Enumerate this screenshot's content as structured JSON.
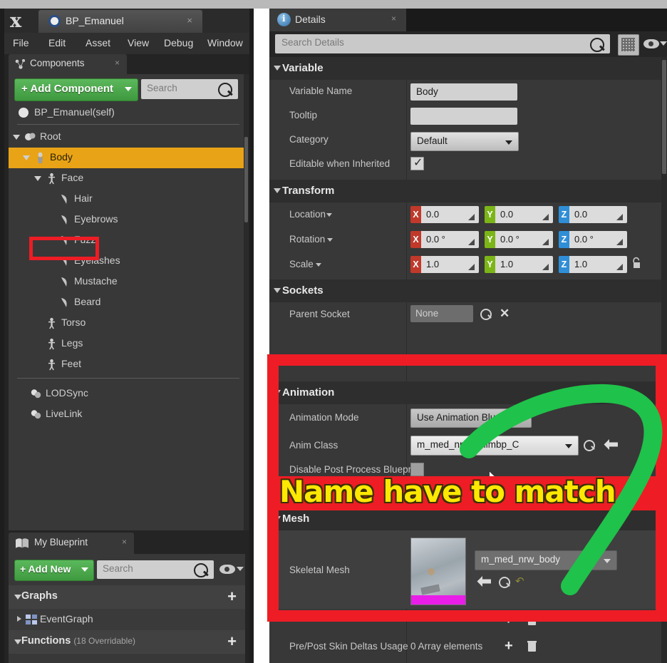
{
  "window": {
    "logo": "unreal-logo",
    "tab_label": "BP_Emanuel",
    "tab_close": "×",
    "menu": [
      "File",
      "Edit",
      "Asset",
      "View",
      "Debug",
      "Window"
    ]
  },
  "components_panel": {
    "tab_label": "Components",
    "tab_close": "×",
    "add_button": "+ Add Component",
    "search_placeholder": "Search",
    "self_item": "BP_Emanuel(self)",
    "tree": [
      {
        "label": "Root",
        "indent": 22,
        "icon": "sphere-mesh-icon",
        "arrow": "open",
        "selected": false
      },
      {
        "label": "Body",
        "indent": 36,
        "icon": "skeletal-mesh-icon",
        "arrow": "open",
        "selected": true
      },
      {
        "label": "Face",
        "indent": 52,
        "icon": "person-icon",
        "arrow": "open",
        "selected": false
      },
      {
        "label": "Hair",
        "indent": 70,
        "icon": "groom-icon",
        "arrow": "none",
        "selected": false
      },
      {
        "label": "Eyebrows",
        "indent": 70,
        "icon": "groom-icon",
        "arrow": "none",
        "selected": false
      },
      {
        "label": "Fuzz",
        "indent": 70,
        "icon": "groom-icon",
        "arrow": "none",
        "selected": false
      },
      {
        "label": "Eyelashes",
        "indent": 70,
        "icon": "groom-icon",
        "arrow": "none",
        "selected": false
      },
      {
        "label": "Mustache",
        "indent": 70,
        "icon": "groom-icon",
        "arrow": "none",
        "selected": false
      },
      {
        "label": "Beard",
        "indent": 70,
        "icon": "groom-icon",
        "arrow": "none",
        "selected": false
      },
      {
        "label": "Torso",
        "indent": 52,
        "icon": "person-icon",
        "arrow": "none",
        "selected": false
      },
      {
        "label": "Legs",
        "indent": 52,
        "icon": "person-icon",
        "arrow": "none",
        "selected": false
      },
      {
        "label": "Feet",
        "indent": 52,
        "icon": "person-icon",
        "arrow": "none",
        "selected": false
      },
      {
        "label": "LODSync",
        "indent": 30,
        "icon": "blueprint-component-icon",
        "arrow": "none",
        "selected": false
      },
      {
        "label": "LiveLink",
        "indent": 30,
        "icon": "blueprint-component-icon",
        "arrow": "none",
        "selected": false
      }
    ]
  },
  "my_blueprint_panel": {
    "tab_label": "My Blueprint",
    "tab_close": "×",
    "add_button": "+ Add New",
    "search_placeholder": "Search",
    "graphs_label": "Graphs",
    "event_graph": "EventGraph",
    "functions_label": "Functions",
    "functions_sub": "(18 Overridable)",
    "plus": "+"
  },
  "details_panel": {
    "tab_label": "Details",
    "tab_close": "×",
    "search_placeholder": "Search Details",
    "sections": {
      "variable": {
        "title": "Variable",
        "rows": {
          "variable_name_label": "Variable Name",
          "variable_name_value": "Body",
          "tooltip_label": "Tooltip",
          "tooltip_value": "",
          "category_label": "Category",
          "category_value": "Default",
          "editable_label": "Editable when Inherited",
          "editable_checked": "✓"
        }
      },
      "transform": {
        "title": "Transform",
        "rows": [
          {
            "label": "Location",
            "x": "0.0",
            "y": "0.0",
            "z": "0.0"
          },
          {
            "label": "Rotation",
            "x": "0.0 °",
            "y": "0.0 °",
            "z": "0.0 °"
          },
          {
            "label": "Scale",
            "x": "1.0",
            "y": "1.0",
            "z": "1.0"
          }
        ],
        "axis_keys": [
          "X",
          "Y",
          "Z"
        ]
      },
      "sockets": {
        "title": "Sockets",
        "parent_socket_label": "Parent Socket",
        "parent_socket_value": "None"
      },
      "animation": {
        "title": "Animation",
        "mode_label": "Animation Mode",
        "mode_value": "Use Animation Blueprint",
        "anim_class_label": "Anim Class",
        "anim_class_value": "m_med_nrw_animbp_C",
        "disable_ppbp_label": "Disable Post Process Bluepri"
      },
      "mesh": {
        "title": "Mesh",
        "skeletal_mesh_label": "Skeletal Mesh",
        "skeletal_mesh_value": "m_med_nrw_body",
        "pre_post_label": "Pre/Post Skin Deltas Usage",
        "pre_post_value": "0 Array elements"
      }
    }
  },
  "annotations": {
    "callout_text": "Name have to match",
    "callout_color": "#ffe800",
    "box_color": "#ee1c25",
    "arrow_color": "#1fc24a",
    "highlight_color": "#e8a317"
  }
}
